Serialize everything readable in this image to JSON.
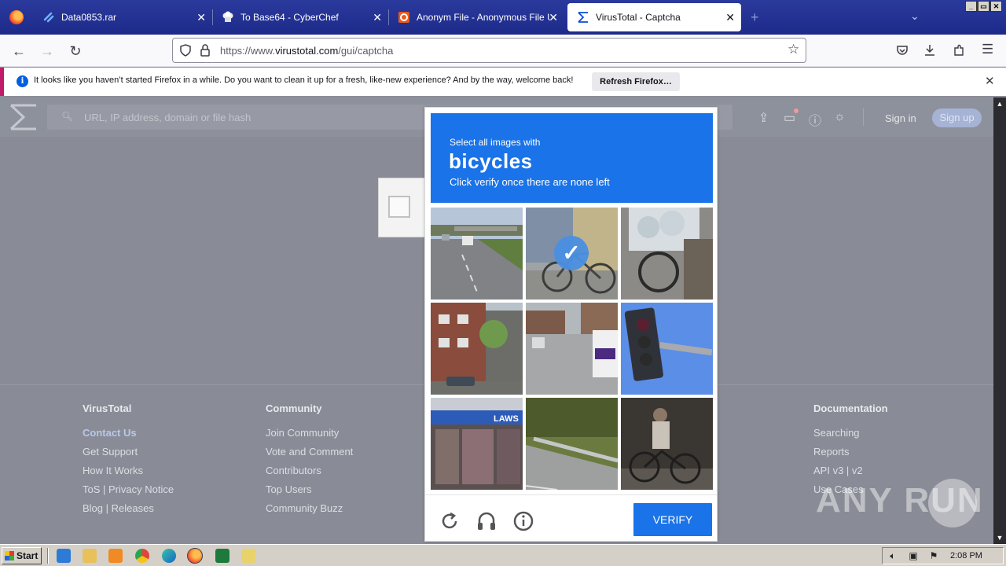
{
  "browser": {
    "tabs": [
      {
        "label": "Data0853.rar",
        "icon": "link-icon"
      },
      {
        "label": "To Base64 - CyberChef",
        "icon": "chef-hat-icon"
      },
      {
        "label": "Anonym File - Anonymous File Uplo",
        "icon": "anonym-logo-icon"
      },
      {
        "label": "VirusTotal - Captcha",
        "icon": "virustotal-icon",
        "active": true
      }
    ],
    "url_prefix": "https://www.",
    "url_domain": "virustotal.com",
    "url_path": "/gui/captcha",
    "notification": {
      "text": "It looks like you haven’t started Firefox in a while. Do you want to clean it up for a fresh, like-new experience? And by the way, welcome back!",
      "button": "Refresh Firefox…"
    }
  },
  "virustotal": {
    "search_placeholder": "URL, IP address, domain or file hash",
    "sign_in": "Sign in",
    "sign_up": "Sign up",
    "footer": [
      {
        "heading": "VirusTotal",
        "links": [
          "Contact Us",
          "Get Support",
          "How It Works",
          "ToS | Privacy Notice",
          "Blog | Releases"
        ]
      },
      {
        "heading": "Community",
        "links": [
          "Join Community",
          "Vote and Comment",
          "Contributors",
          "Top Users",
          "Community Buzz"
        ]
      },
      {
        "heading": "Documentation",
        "links": [
          "Searching",
          "Reports",
          "API v3 | v2",
          "Use Cases"
        ]
      }
    ]
  },
  "captcha": {
    "prompt": "Select all images with",
    "target": "bicycles",
    "instruction": "Click verify once there are none left",
    "verify_label": "VERIFY",
    "tiles": [
      {
        "subject": "highway",
        "selected": false
      },
      {
        "subject": "bicycle",
        "selected": true
      },
      {
        "subject": "bicycle-with-bags",
        "selected": false
      },
      {
        "subject": "apartment-building",
        "selected": false
      },
      {
        "subject": "street-with-van",
        "selected": false
      },
      {
        "subject": "traffic-light",
        "selected": false
      },
      {
        "subject": "storefront",
        "selected": false
      },
      {
        "subject": "guardrail-road",
        "selected": false
      },
      {
        "subject": "person-with-bicycle",
        "selected": false
      }
    ],
    "accent": "#1a73e8"
  },
  "watermark": "ANY RUN",
  "taskbar": {
    "start_label": "Start",
    "clock": "2:08 PM"
  }
}
